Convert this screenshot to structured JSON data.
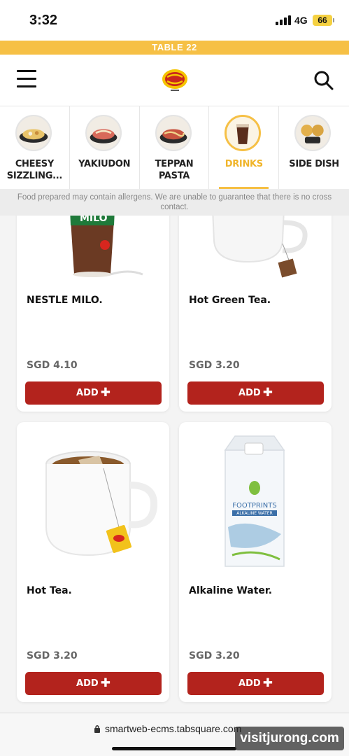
{
  "status_bar": {
    "time": "3:32",
    "network": "4G",
    "battery": "66"
  },
  "table_banner": "TABLE 22",
  "header": {
    "logo_name": "Pepper Lunch"
  },
  "categories": [
    {
      "label": "CHEESY SIZZLING...",
      "active": false
    },
    {
      "label": "YAKIUDON",
      "active": false
    },
    {
      "label": "TEPPAN PASTA",
      "active": false
    },
    {
      "label": "DRINKS",
      "active": true
    },
    {
      "label": "SIDE DISH",
      "active": false
    }
  ],
  "notice": "Food prepared may contain allergens. We are unable to guarantee that there is no cross contact.",
  "products": [
    {
      "name": "NESTLE MILO.",
      "price": "SGD 4.10",
      "add_label": "ADD"
    },
    {
      "name": "Hot Green Tea.",
      "price": "SGD 3.20",
      "add_label": "ADD"
    },
    {
      "name": "Hot Tea.",
      "price": "SGD 3.20",
      "add_label": "ADD"
    },
    {
      "name": "Alkaline Water.",
      "price": "SGD 3.20",
      "add_label": "ADD"
    }
  ],
  "browser": {
    "url": "smartweb-ecms.tabsquare.com"
  },
  "watermark": "visitjurong.com",
  "colors": {
    "accent": "#f6c045",
    "button": "#b3231d"
  }
}
